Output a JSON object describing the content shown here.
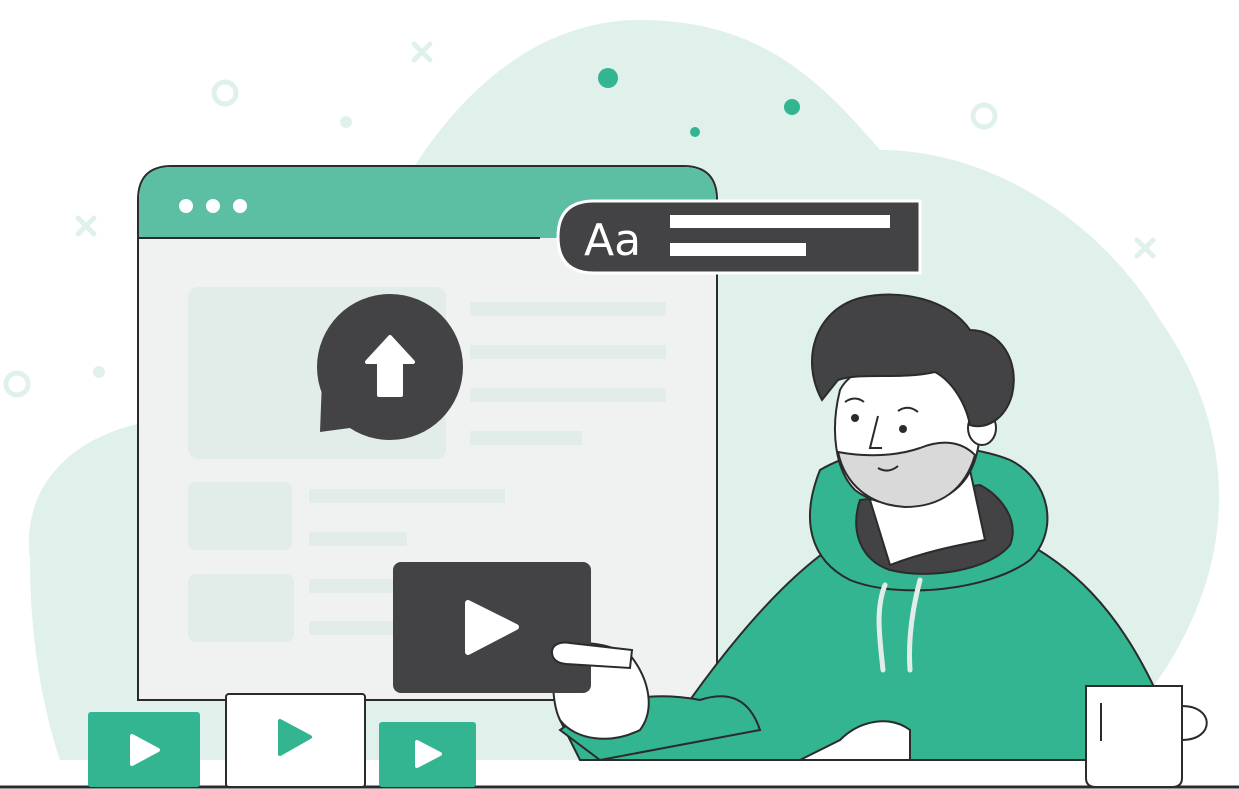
{
  "colors": {
    "accent": "#33b592",
    "accent_light": "#5cbea2",
    "blob": "#e0f0eb",
    "dark": "#434345",
    "browser_bg": "#f0f2f1",
    "placeholder": "#e2ede9",
    "skin": "#ffffff",
    "beard": "#d9d9d9",
    "outline": "#2b2b2b"
  },
  "font_badge": {
    "label": "Aa"
  },
  "icons": {
    "upload": "upload-arrow-icon",
    "play": "play-icon"
  }
}
